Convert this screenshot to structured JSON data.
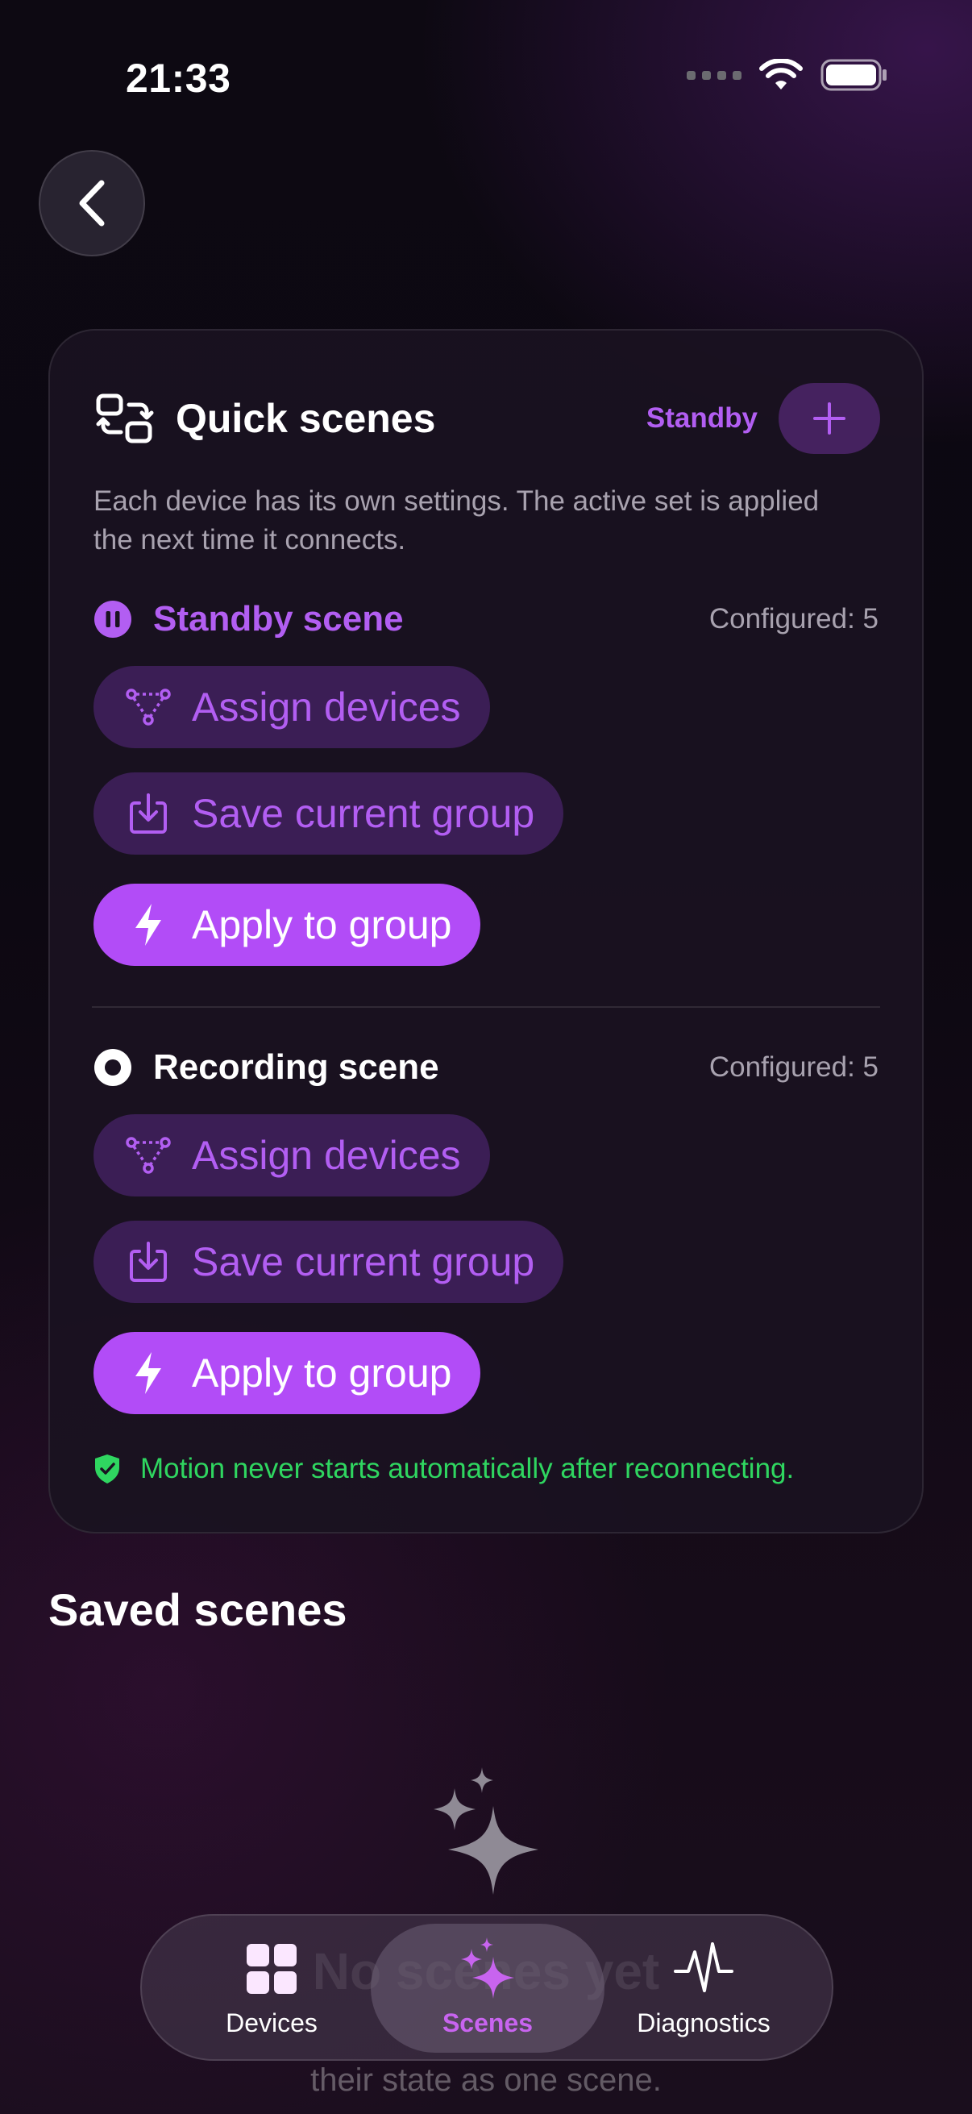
{
  "status": {
    "time": "21:33"
  },
  "card": {
    "title": "Quick scenes",
    "mode_label": "Standby",
    "description": "Each device has its own settings. The active set is applied the next time it connects.",
    "scenes": [
      {
        "name": "Standby scene",
        "configured": "Configured: 5",
        "assign_label": "Assign devices",
        "save_label": "Save current group",
        "apply_label": "Apply to group"
      },
      {
        "name": "Recording scene",
        "configured": "Configured: 5",
        "assign_label": "Assign devices",
        "save_label": "Save current group",
        "apply_label": "Apply to group"
      }
    ],
    "safety_note": "Motion never starts automatically after reconnecting."
  },
  "saved": {
    "title": "Saved scenes",
    "empty_title": "No scenes yet",
    "empty_text": "their state as one scene."
  },
  "tabs": [
    {
      "label": "Devices"
    },
    {
      "label": "Scenes"
    },
    {
      "label": "Diagnostics"
    }
  ],
  "colors": {
    "accent": "#b24cf7",
    "accent_text": "#b25ef2",
    "success": "#2fd660"
  }
}
